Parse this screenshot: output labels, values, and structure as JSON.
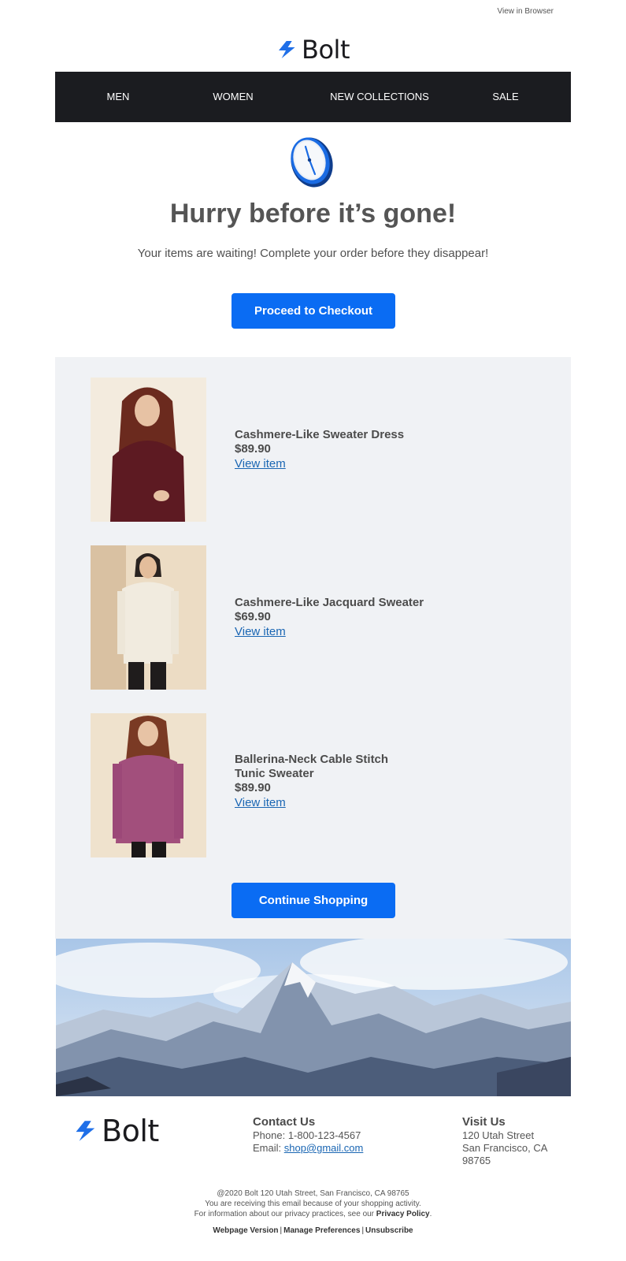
{
  "header": {
    "view_in_browser": "View in Browser",
    "brand": "Bolt"
  },
  "nav": {
    "items": [
      {
        "label": "MEN"
      },
      {
        "label": "WOMEN"
      },
      {
        "label": "NEW COLLECTIONS"
      },
      {
        "label": "SALE"
      }
    ]
  },
  "hero": {
    "title": "Hurry before it’s gone!",
    "subtitle": "Your items are waiting! Complete your order before they disappear!",
    "cta_label": "Proceed to Checkout"
  },
  "items": [
    {
      "name": "Cashmere-Like Sweater Dress",
      "price": "$89.90",
      "link_label": "View item",
      "color": "#5d1a22"
    },
    {
      "name": "Cashmere-Like Jacquard Sweater",
      "price": "$69.90",
      "link_label": "View item",
      "color": "#ede6d8"
    },
    {
      "name": "Ballerina-Neck Cable Stitch Tunic Sweater",
      "price": "$89.90",
      "link_label": "View item",
      "color": "#a24f7c"
    }
  ],
  "continue_label": "Continue Shopping",
  "footer": {
    "brand": "Bolt",
    "contact": {
      "heading": "Contact Us",
      "phone": "Phone: 1-800-123-4567",
      "email_prefix": "Email: ",
      "email": "shop@gmail.com"
    },
    "visit": {
      "heading": "Visit Us",
      "line1": "120 Utah Street",
      "line2": "San Francisco, CA",
      "line3": "98765"
    },
    "legal": {
      "line1": "@2020 Bolt 120 Utah Street, San Francisco, CA 98765",
      "line2": "You are receiving this email because of your shopping activity.",
      "line3_prefix": "For information about our privacy practices, see our ",
      "privacy_label": "Privacy Policy",
      "line3_suffix": "."
    },
    "links": {
      "webpage": "Webpage Version",
      "preferences": "Manage Preferences",
      "unsubscribe": "Unsubscribe"
    }
  },
  "colors": {
    "accent": "#0a6cf3",
    "nav_bg": "#1b1c20",
    "panel_bg": "#f0f2f5",
    "link": "#1a66b3"
  }
}
